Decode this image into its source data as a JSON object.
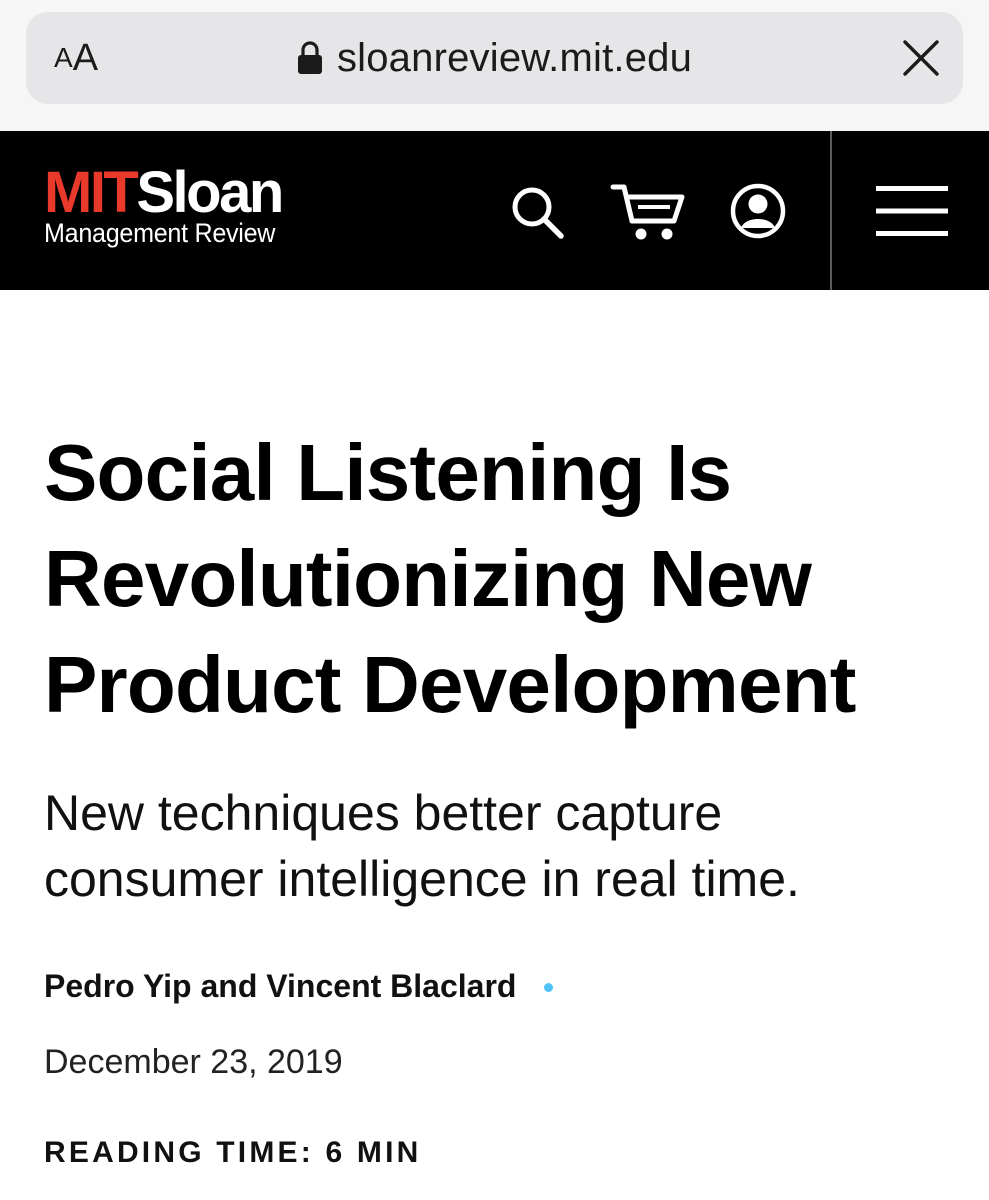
{
  "browser": {
    "reader_small": "A",
    "reader_large": "A",
    "url": "sloanreview.mit.edu",
    "icons": [
      "lock-icon",
      "close-icon"
    ]
  },
  "header": {
    "logo": {
      "mit": "MIT",
      "sloan": "Sloan",
      "subtitle": "Management Review"
    },
    "icons": [
      "search-icon",
      "cart-icon",
      "account-icon",
      "menu-icon"
    ],
    "colors": {
      "background": "#000000",
      "brand_red": "#e8392b"
    }
  },
  "article": {
    "headline": "Social Listening Is Revolutionizing New Product Development",
    "deck": "New techniques better capture consumer intelligence in real time.",
    "authors": "Pedro Yip and Vincent Blaclard",
    "date": "December 23, 2019",
    "reading_time": "READING TIME: 6 MIN",
    "accent_dot_color": "#4fc3f7"
  }
}
